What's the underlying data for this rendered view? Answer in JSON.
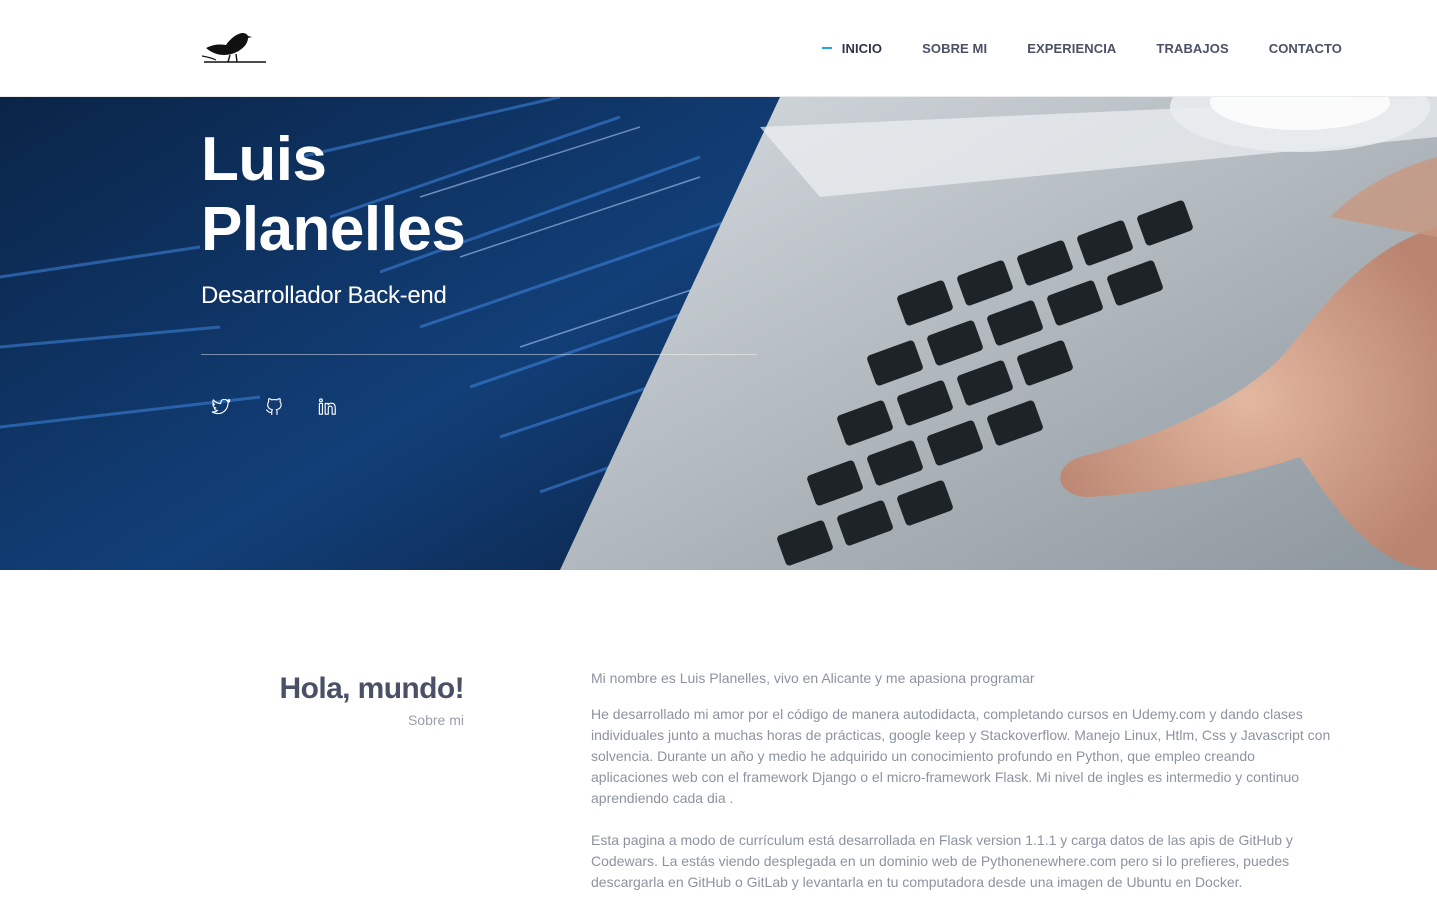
{
  "header": {
    "logo": "bird-logo-icon",
    "nav": [
      {
        "label": "INICIO",
        "active": true
      },
      {
        "label": "SOBRE MI",
        "active": false
      },
      {
        "label": "EXPERIENCIA",
        "active": false
      },
      {
        "label": "TRABAJOS",
        "active": false
      },
      {
        "label": "CONTACTO",
        "active": false
      }
    ],
    "accent_color": "#2aa6d6"
  },
  "hero": {
    "name_line1": "Luis",
    "name_line2": "Planelles",
    "subtitle": "Desarrollador Back-end",
    "social": [
      {
        "icon": "twitter-icon"
      },
      {
        "icon": "github-icon"
      },
      {
        "icon": "linkedin-icon"
      }
    ]
  },
  "about": {
    "title": "Hola, mundo!",
    "subtitle": "Sobre mi",
    "paragraphs": [
      "Mi nombre es Luis Planelles, vivo en Alicante y me apasiona programar",
      "He desarrollado mi amor por el código de manera autodidacta, completando cursos en Udemy.com y dando clases individuales junto a muchas horas de prácticas, google keep y Stackoverflow. Manejo Linux, Htlm, Css y Javascript con solvencia. Durante un año y medio he adquirido un conocimiento profundo en Python, que empleo creando aplicaciones web con el framework Django o el micro-framework Flask. Mi nivel de ingles es intermedio y continuo aprendiendo cada dia .",
      "Esta pagina a modo de currículum está desarrollada en Flask version 1.1.1 y carga datos de las apis de GitHub y Codewars. La estás viendo desplegada en un dominio web de Pythonenewhere.com pero si lo prefieres, puedes descargarla en GitHub o GitLab y levantarla en tu computadora desde una imagen de Ubuntu en Docker."
    ]
  }
}
